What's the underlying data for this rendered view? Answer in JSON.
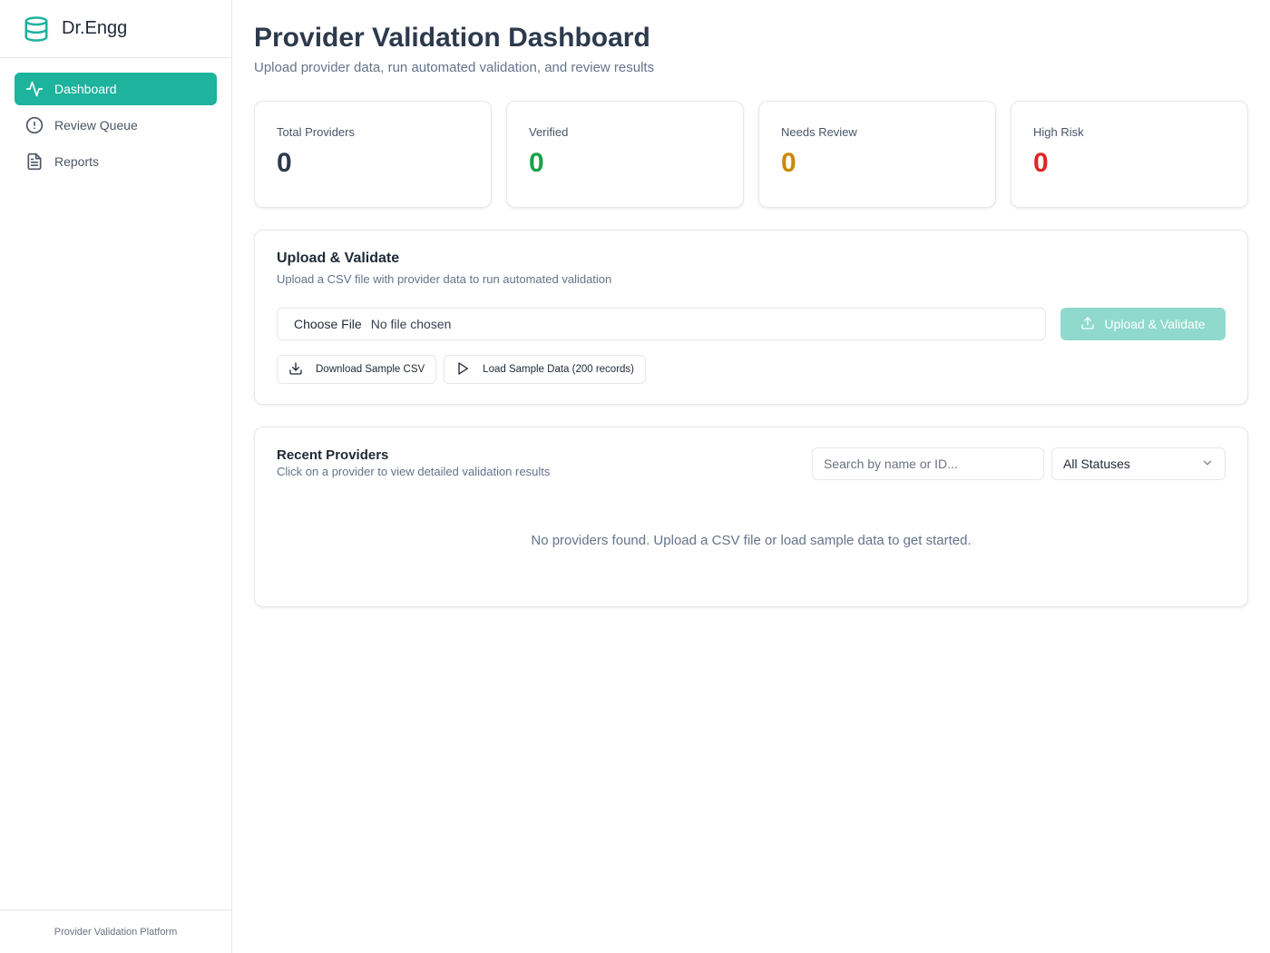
{
  "brand": {
    "name": "Dr.Engg",
    "icon": "database-icon",
    "accent": "#1db39d"
  },
  "nav": {
    "items": [
      {
        "label": "Dashboard",
        "icon": "activity-icon",
        "active": true
      },
      {
        "label": "Review Queue",
        "icon": "alert-circle-icon",
        "active": false
      },
      {
        "label": "Reports",
        "icon": "file-text-icon",
        "active": false
      }
    ]
  },
  "footer": {
    "text": "Provider Validation Platform"
  },
  "page": {
    "title": "Provider Validation Dashboard",
    "subtitle": "Upload provider data, run automated validation, and review results"
  },
  "stats": [
    {
      "label": "Total Providers",
      "value": "0",
      "color": "#2d3a4d"
    },
    {
      "label": "Verified",
      "value": "0",
      "color": "#16a34a"
    },
    {
      "label": "Needs Review",
      "value": "0",
      "color": "#ca8a04"
    },
    {
      "label": "High Risk",
      "value": "0",
      "color": "#dc2626"
    }
  ],
  "upload": {
    "title": "Upload & Validate",
    "description": "Upload a CSV file with provider data to run automated validation",
    "file_button": "Choose File",
    "file_status": "No file chosen",
    "submit_label": "Upload & Validate",
    "download_label": "Download Sample CSV",
    "load_sample_label": "Load Sample Data (200 records)"
  },
  "recent": {
    "title": "Recent Providers",
    "description": "Click on a provider to view detailed validation results",
    "search_placeholder": "Search by name or ID...",
    "status_filter": "All Statuses",
    "empty_message": "No providers found. Upload a CSV file or load sample data to get started."
  }
}
